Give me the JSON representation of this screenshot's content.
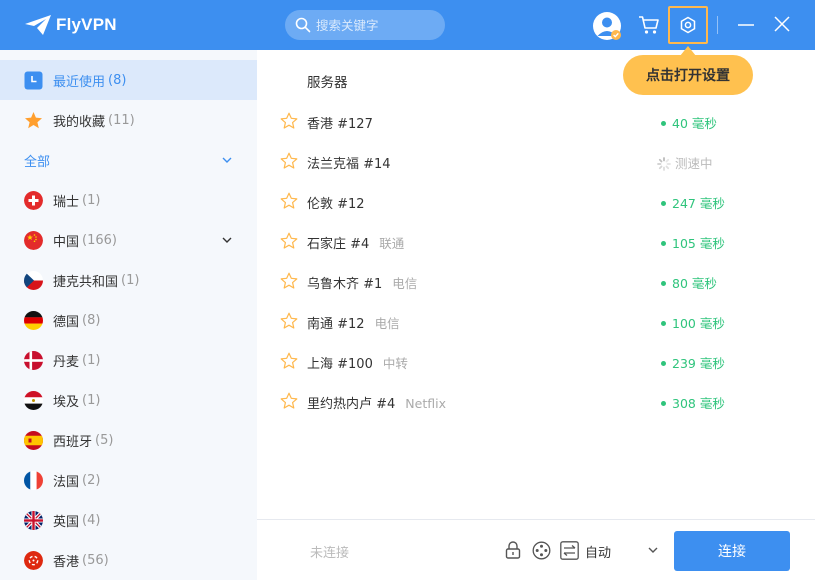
{
  "app": {
    "name": "FlyVPN"
  },
  "colors": {
    "accent": "#3d8ff0",
    "ping_good": "#2fc47c",
    "tooltip": "#ffc14f",
    "favorite": "#ff9f2e"
  },
  "header": {
    "search_placeholder": "搜索关键字",
    "icons": [
      "logo-icon",
      "search-icon",
      "avatar-icon",
      "cart-icon",
      "gear-icon",
      "minimize-icon",
      "close-icon"
    ]
  },
  "tooltip": {
    "text": "点击打开设置"
  },
  "sidebar": {
    "recent": {
      "label": "最近使用",
      "count": "(8)"
    },
    "favorites": {
      "label": "我的收藏",
      "count": "(11)"
    },
    "all": {
      "label": "全部"
    },
    "countries": [
      {
        "label": "瑞士",
        "count": "(1)",
        "flag": "switzerland-flag"
      },
      {
        "label": "中国",
        "count": "(166)",
        "flag": "china-flag"
      },
      {
        "label": "捷克共和国",
        "count": "(1)",
        "flag": "czech-flag"
      },
      {
        "label": "德国",
        "count": "(8)",
        "flag": "germany-flag"
      },
      {
        "label": "丹麦",
        "count": "(1)",
        "flag": "denmark-flag"
      },
      {
        "label": "埃及",
        "count": "(1)",
        "flag": "egypt-flag"
      },
      {
        "label": "西班牙",
        "count": "(5)",
        "flag": "spain-flag"
      },
      {
        "label": "法国",
        "count": "(2)",
        "flag": "france-flag"
      },
      {
        "label": "英国",
        "count": "(4)",
        "flag": "uk-flag"
      },
      {
        "label": "香港",
        "count": "(56)",
        "flag": "hongkong-flag"
      }
    ]
  },
  "list": {
    "header": "服务器",
    "rows": [
      {
        "name": "香港 #127",
        "tag": "",
        "ping": "40 毫秒"
      },
      {
        "name": "法兰克福 #14",
        "tag": "",
        "ping": "测速中",
        "testing": true
      },
      {
        "name": "伦敦 #12",
        "tag": "",
        "ping": "247 毫秒"
      },
      {
        "name": "石家庄 #4",
        "tag": "联通",
        "ping": "105 毫秒"
      },
      {
        "name": "乌鲁木齐 #1",
        "tag": "电信",
        "ping": "80 毫秒"
      },
      {
        "name": "南通 #12",
        "tag": "电信",
        "ping": "100 毫秒"
      },
      {
        "name": "上海 #100",
        "tag": "中转",
        "ping": "239 毫秒"
      },
      {
        "name": "里约热内卢 #4",
        "tag": "Netflix",
        "ping": "308 毫秒"
      }
    ]
  },
  "bottom": {
    "status": "未连接",
    "protocol": "自动",
    "connect_label": "连接"
  }
}
